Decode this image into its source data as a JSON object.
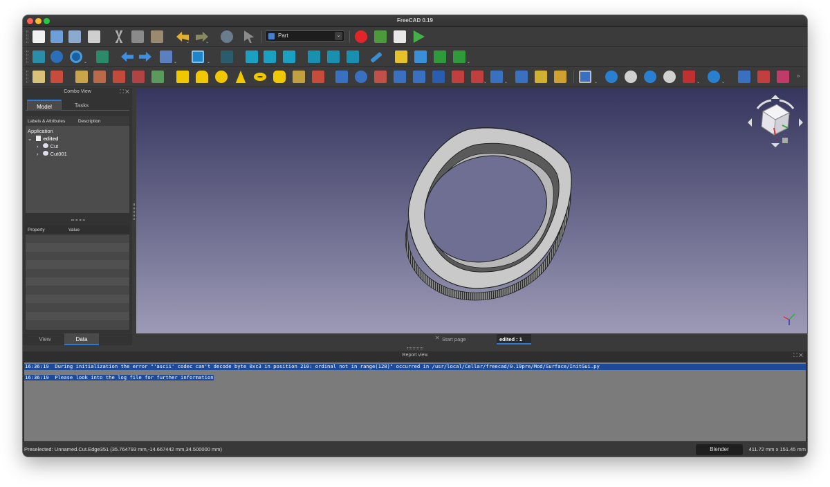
{
  "window": {
    "title": "FreeCAD 0.19"
  },
  "toolbar": {
    "workbench": "Part"
  },
  "combo_view": {
    "title": "Combo View",
    "tabs": [
      "Model",
      "Tasks"
    ],
    "tree_columns": [
      "Labels & Attributes",
      "Description"
    ],
    "tree_root": "Application",
    "document": "edited",
    "objects": [
      "Cut",
      "Cut001"
    ],
    "property_columns": [
      "Property",
      "Value"
    ],
    "bottom_tabs": [
      "View",
      "Data"
    ]
  },
  "doc_tabs": [
    "Start page",
    "edited : 1"
  ],
  "report_view": {
    "title": "Report view",
    "lines": [
      "16:36:19  During initialization the error \"'ascii' codec can't decode byte 0xc3 in position 210: ordinal not in range(128)\" occurred in /usr/local/Cellar/freecad/0.19pre/Mod/Surface/InitGui.py",
      "16:36:19  Please look into the log file for further information"
    ]
  },
  "status": {
    "message": "Preselected: Unnamed.Cut.Edge351 (35.764793 mm,-14.667442 mm,34.500000 mm)",
    "navigation_style": "Blender",
    "dimensions": "411.72 mm x 151.45 mm"
  },
  "colors": {
    "accent": "#2c7ad6",
    "viewport_top": "#35355e",
    "viewport_bottom": "#9c9ab6",
    "report_highlight": "#1e4a9a"
  }
}
